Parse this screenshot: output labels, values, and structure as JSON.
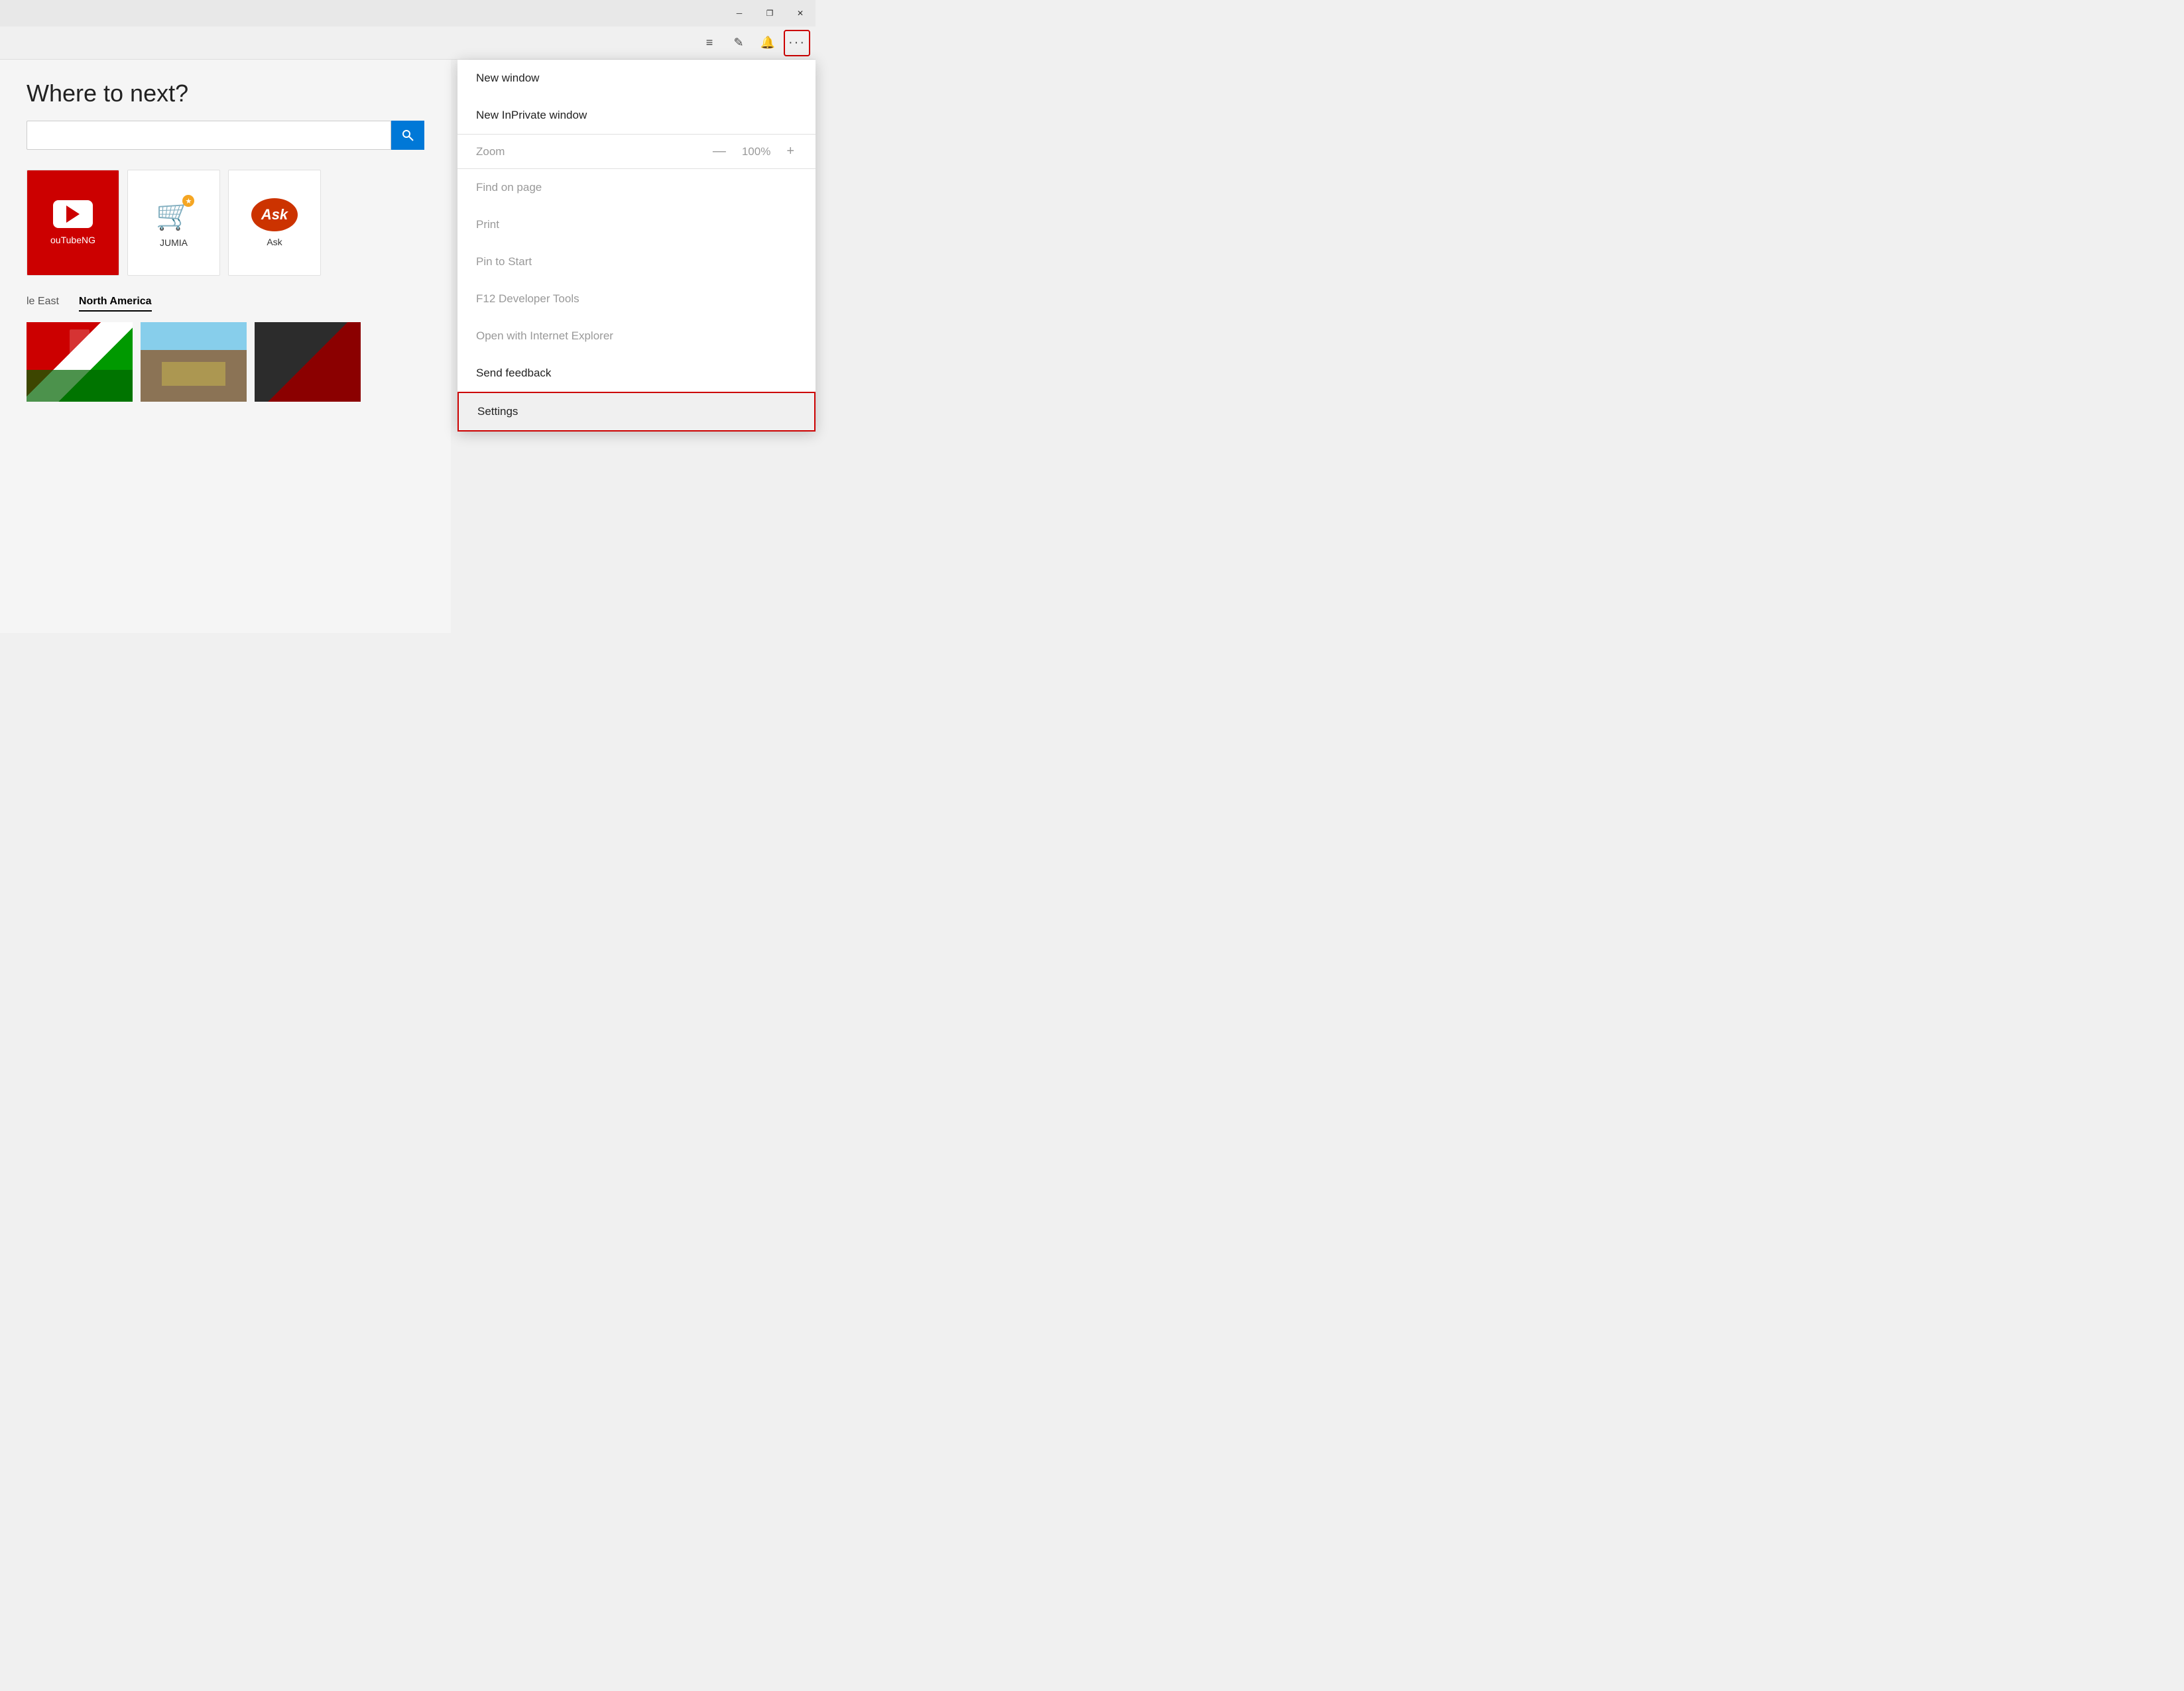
{
  "titlebar": {
    "minimize_label": "─",
    "restore_label": "❐",
    "close_label": "✕"
  },
  "toolbar": {
    "hub_icon": "≡",
    "note_icon": "✎",
    "notifications_icon": "🔔",
    "more_icon": "•••"
  },
  "page": {
    "heading": "Where to next?",
    "search_placeholder": ""
  },
  "tiles": [
    {
      "id": "youtube",
      "label": "ouTubeNG",
      "type": "youtube"
    },
    {
      "id": "jumia",
      "label": "JUMIA",
      "type": "jumia"
    },
    {
      "id": "ask",
      "label": "Ask",
      "type": "ask"
    }
  ],
  "region_tabs": [
    {
      "id": "middle-east",
      "label": "le East",
      "active": false
    },
    {
      "id": "north-america",
      "label": "North America",
      "active": true
    }
  ],
  "menu": {
    "new_window": "New window",
    "new_inprivate": "New InPrivate window",
    "zoom_label": "Zoom",
    "zoom_value": "100%",
    "zoom_minus": "—",
    "zoom_plus": "+",
    "find_on_page": "Find on page",
    "print": "Print",
    "pin_to_start": "Pin to Start",
    "f12_tools": "F12 Developer Tools",
    "open_ie": "Open with Internet Explorer",
    "send_feedback": "Send feedback",
    "settings": "Settings"
  },
  "colors": {
    "accent_red": "#cc0000",
    "border_red": "#cc0000",
    "accent_blue": "#0078d7",
    "text_muted": "#999999",
    "settings_bg": "#f0f0f0"
  }
}
